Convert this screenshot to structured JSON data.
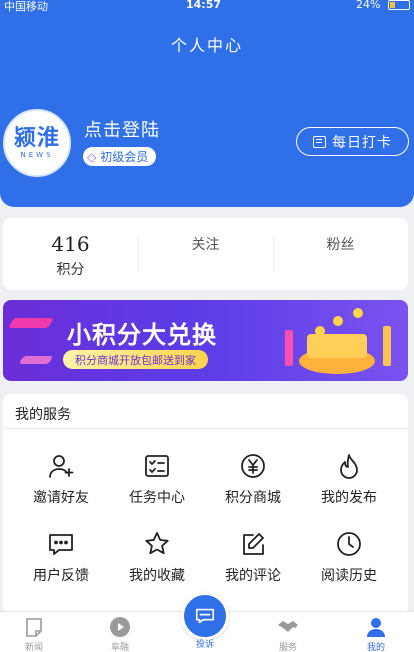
{
  "status_bar": {
    "carrier": "中国移动",
    "time": "14:57",
    "battery": "24%"
  },
  "header": {
    "title": "个人中心",
    "login_text": "点击登陆",
    "member_level": "初级会员",
    "checkin_label": "每日打卡",
    "logo_text": "颍淮",
    "logo_sub": "NEWS"
  },
  "stats": [
    {
      "value": "416",
      "label": "积分"
    },
    {
      "label": "关注"
    },
    {
      "label": "粉丝"
    }
  ],
  "banner": {
    "title": "小积分大兑换",
    "subtitle": "积分商城开放包邮送到家"
  },
  "services": {
    "title": "我的服务",
    "items": [
      {
        "label": "邀请好友",
        "icon": "add-user-icon"
      },
      {
        "label": "任务中心",
        "icon": "task-icon"
      },
      {
        "label": "积分商城",
        "icon": "yen-icon"
      },
      {
        "label": "我的发布",
        "icon": "flame-icon"
      },
      {
        "label": "用户反馈",
        "icon": "feedback-icon"
      },
      {
        "label": "我的收藏",
        "icon": "star-icon"
      },
      {
        "label": "我的评论",
        "icon": "edit-icon"
      },
      {
        "label": "阅读历史",
        "icon": "clock-icon"
      }
    ]
  },
  "tabbar": {
    "items": [
      {
        "label": "新闻",
        "icon": "news-icon"
      },
      {
        "label": "阜融",
        "icon": "play-icon"
      },
      {
        "label": "投诉",
        "icon": "chat-icon"
      },
      {
        "label": "服务",
        "icon": "handshake-icon"
      },
      {
        "label": "我的",
        "icon": "user-icon"
      }
    ]
  },
  "colors": {
    "primary": "#2f6fe8",
    "background": "#eef0f4"
  }
}
